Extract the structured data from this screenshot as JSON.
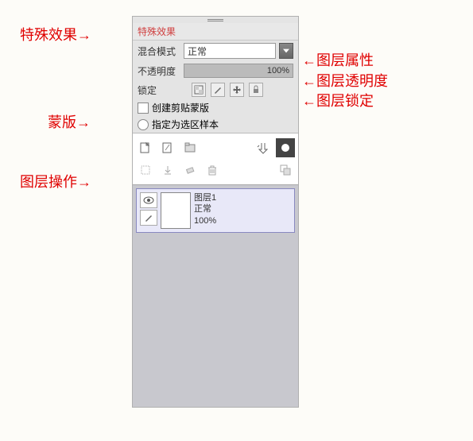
{
  "panel": {
    "header": "特殊效果",
    "blend_label": "混合模式",
    "blend_value": "正常",
    "opacity_label": "不透明度",
    "opacity_value": "100%",
    "lock_label": "锁定",
    "clip_mask_label": "创建剪贴蒙版",
    "selection_label": "指定为选区样本"
  },
  "layer": {
    "name": "图层1",
    "mode": "正常",
    "opacity": "100%"
  },
  "annotations": {
    "special_fx": "特殊效果",
    "layer_props": "图层属性",
    "layer_opacity": "图层透明度",
    "layer_lock": "图层锁定",
    "mask": "蒙版",
    "layer_ops": "图层操作"
  }
}
